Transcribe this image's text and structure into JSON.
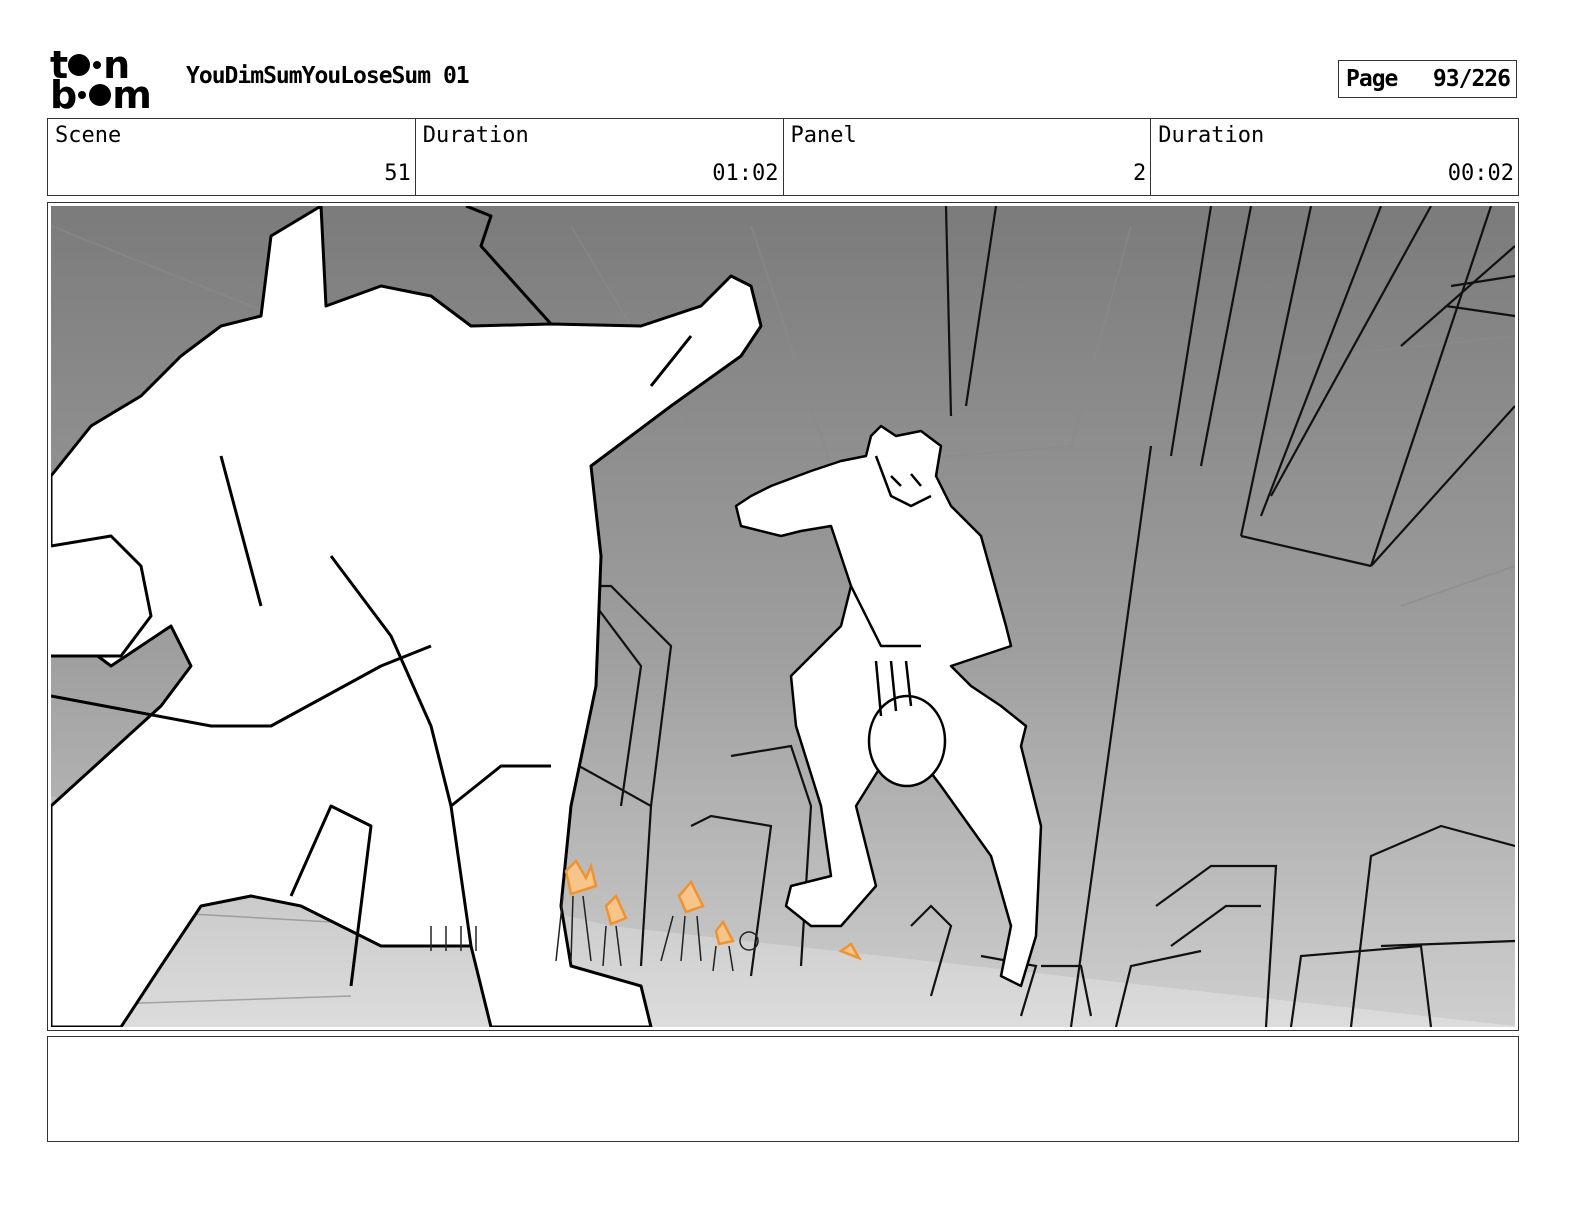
{
  "header": {
    "logo_top": "t",
    "logo_top_end": "n",
    "logo_bottom": "b",
    "logo_bottom_end": "m",
    "project_title": "YouDimSumYouLoseSum 01",
    "page_label": "Page",
    "page_value": "93/226"
  },
  "info": {
    "scene_label": "Scene",
    "scene_value": "51",
    "duration_label": "Duration",
    "duration_value": "01:02",
    "panel_label": "Panel",
    "panel_value": "2",
    "panel_duration_label": "Duration",
    "panel_duration_value": "00:02"
  },
  "notes": {
    "text": ""
  },
  "colors": {
    "accent_orange": "#f0922f",
    "panel_sky_top": "#7d7d7d",
    "panel_floor": "#c9c9c9"
  }
}
